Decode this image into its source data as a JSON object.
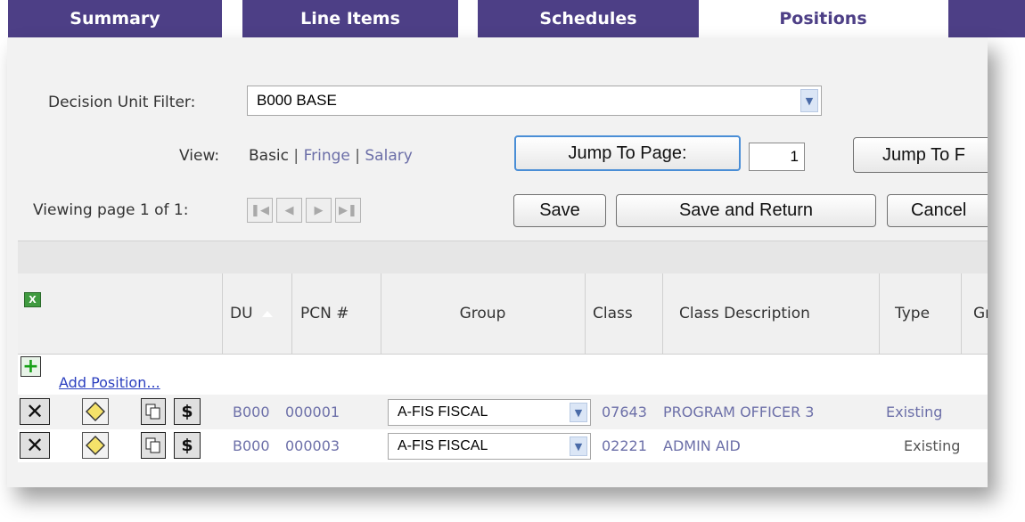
{
  "tabs": [
    {
      "label": "Summary",
      "active": false
    },
    {
      "label": "Line Items",
      "active": false
    },
    {
      "label": "Schedules",
      "active": false
    },
    {
      "label": "Positions",
      "active": true
    }
  ],
  "filter": {
    "label": "Decision Unit Filter:",
    "value": "B000 BASE"
  },
  "view": {
    "label": "View:",
    "basic": "Basic",
    "sep": "|",
    "fringe": "Fringe",
    "salary": "Salary"
  },
  "jump": {
    "button_label": "Jump To Page:",
    "page_value": "1",
    "button2_label": "Jump To F"
  },
  "paging": {
    "label": "Viewing page 1 of 1:"
  },
  "actions": {
    "save": "Save",
    "save_and_return": "Save and Return",
    "cancel": "Cancel"
  },
  "grid": {
    "columns": {
      "du": "DU",
      "pcn": "PCN #",
      "group": "Group",
      "class": "Class",
      "class_description": "Class Description",
      "type": "Type",
      "partial": "Gr"
    },
    "add_position": "Add Position...",
    "rows": [
      {
        "du": "B000",
        "pcn": "000001",
        "group": "A-FIS FISCAL",
        "class": "07643",
        "description": "PROGRAM OFFICER 3",
        "type": "Existing"
      },
      {
        "du": "B000",
        "pcn": "000003",
        "group": "A-FIS FISCAL",
        "class": "02221",
        "description": "ADMIN AID",
        "type": "Existing"
      }
    ]
  },
  "colors": {
    "tab_bg": "#4d3f86",
    "link": "#6c6fa8",
    "panel_bg": "#f2f2f2"
  }
}
